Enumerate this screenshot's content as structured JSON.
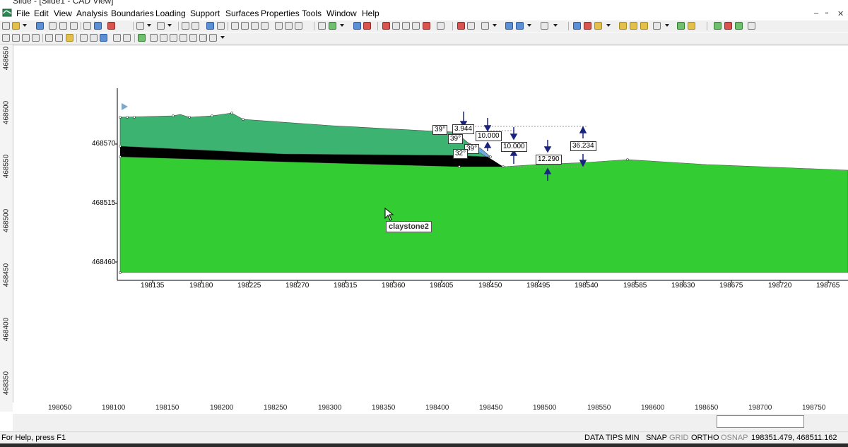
{
  "window": {
    "title": "Slide - [Slide1 - CAD View]"
  },
  "menu": {
    "items": [
      "File",
      "Edit",
      "View",
      "Analysis",
      "Boundaries",
      "Loading",
      "Support",
      "Surfaces",
      "Properties",
      "Tools",
      "Window",
      "Help"
    ]
  },
  "window_controls": {
    "minimize": "–",
    "restore": "▫",
    "close": "✕"
  },
  "ruler_left": {
    "labels": [
      "468650",
      "468600",
      "468550",
      "468500",
      "468450",
      "468400",
      "468350"
    ]
  },
  "ruler_bottom": {
    "labels": [
      "198050",
      "198100",
      "198150",
      "198200",
      "198250",
      "198300",
      "198350",
      "198400",
      "198450",
      "198500",
      "198550",
      "198600",
      "198650",
      "198700",
      "198750"
    ]
  },
  "model": {
    "y_axis_labels": [
      "468570",
      "468515",
      "468460"
    ],
    "x_axis_labels": [
      "198135",
      "198180",
      "198225",
      "198270",
      "198315",
      "198360",
      "198405",
      "198450",
      "198495",
      "198540",
      "198585",
      "198630",
      "198675",
      "198720",
      "198765"
    ],
    "material_label": "claystone2",
    "angle_labels": [
      "39°",
      "39°",
      "39°",
      "32°"
    ],
    "dimension_labels": [
      "3.944",
      "10.000",
      "10.000",
      "12.290",
      "36.234"
    ],
    "colors": {
      "upper_layer": "#3cb371",
      "thin_layer": "#000000",
      "lower_layer": "#33cc33",
      "dimension_arrow": "#1a237e"
    }
  },
  "status": {
    "help": "For Help, press F1",
    "items": [
      "DATA TIPS MIN",
      "SNAP",
      "GRID",
      "ORTHO",
      "OSNAP"
    ],
    "active": [
      true,
      true,
      false,
      true,
      false
    ],
    "coords": "198351.479,  468511.162"
  }
}
